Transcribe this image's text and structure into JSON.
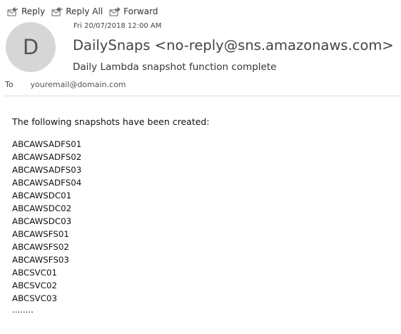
{
  "toolbar": {
    "reply": "Reply",
    "reply_all": "Reply All",
    "forward": "Forward"
  },
  "message": {
    "avatar_initial": "D",
    "date": "Fri 20/07/2018 12:00 AM",
    "sender": "DailySnaps <no-reply@sns.amazonaws.com>",
    "subject": "Daily Lambda snapshot function complete",
    "to_label": "To",
    "to_value": "youremail@domain.com"
  },
  "body": {
    "intro": "The following snapshots have been created:",
    "snapshots": [
      "ABCAWSADFS01",
      "ABCAWSADFS02",
      "ABCAWSADFS03",
      "ABCAWSADFS04",
      "ABCAWSDC01",
      "ABCAWSDC02",
      "ABCAWSDC03",
      "ABCAWSFS01",
      "ABCAWSFS02",
      "ABCAWSFS03",
      "ABCSVC01",
      "ABCSVC02",
      "ABCSVC03"
    ],
    "ellipsis": "........"
  }
}
